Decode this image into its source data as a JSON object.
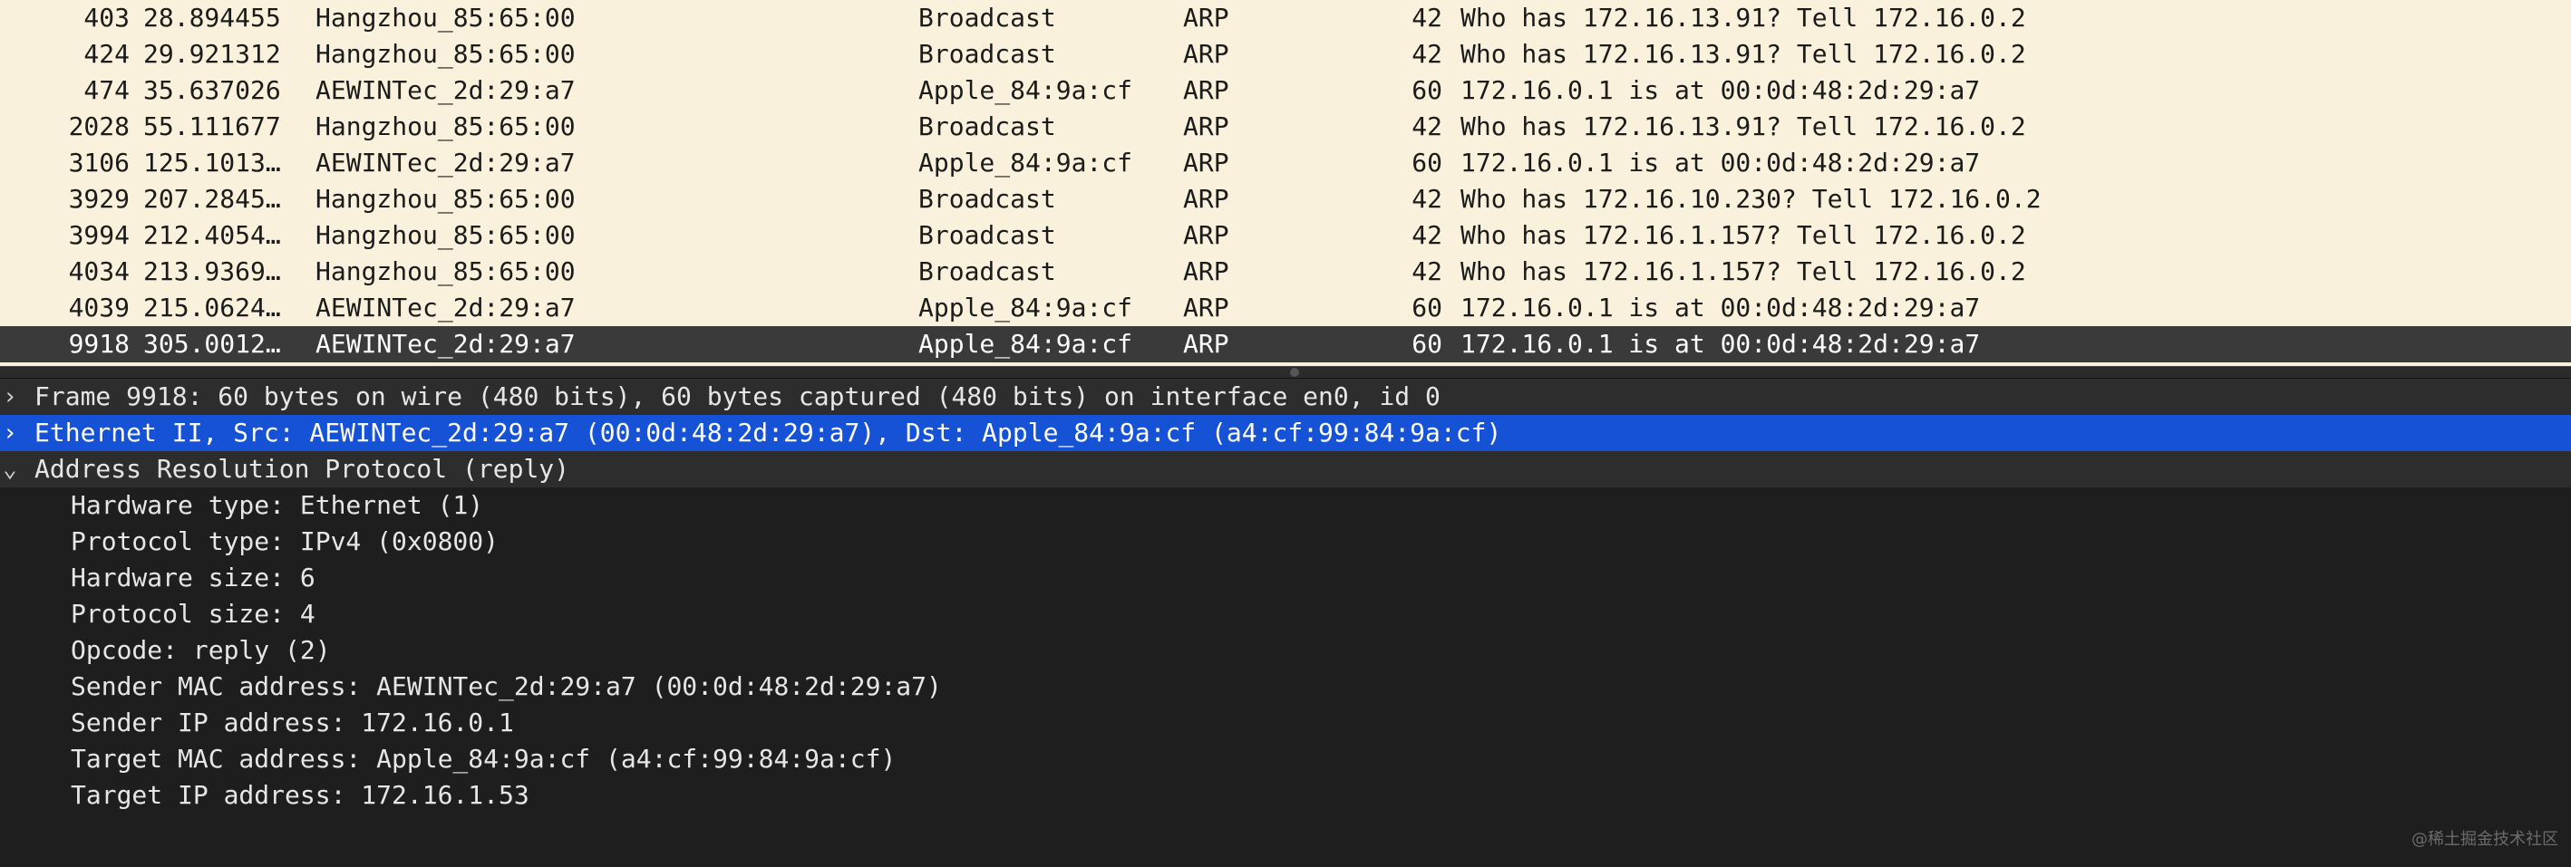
{
  "packets": [
    {
      "no": "403",
      "time": "28.894455",
      "source": "Hangzhou_85:65:00",
      "destination": "Broadcast",
      "protocol": "ARP",
      "length": "42",
      "info": "Who has 172.16.13.91? Tell 172.16.0.2"
    },
    {
      "no": "424",
      "time": "29.921312",
      "source": "Hangzhou_85:65:00",
      "destination": "Broadcast",
      "protocol": "ARP",
      "length": "42",
      "info": "Who has 172.16.13.91? Tell 172.16.0.2"
    },
    {
      "no": "474",
      "time": "35.637026",
      "source": "AEWINTec_2d:29:a7",
      "destination": "Apple_84:9a:cf",
      "protocol": "ARP",
      "length": "60",
      "info": "172.16.0.1 is at 00:0d:48:2d:29:a7"
    },
    {
      "no": "2028",
      "time": "55.111677",
      "source": "Hangzhou_85:65:00",
      "destination": "Broadcast",
      "protocol": "ARP",
      "length": "42",
      "info": "Who has 172.16.13.91? Tell 172.16.0.2"
    },
    {
      "no": "3106",
      "time": "125.1013…",
      "source": "AEWINTec_2d:29:a7",
      "destination": "Apple_84:9a:cf",
      "protocol": "ARP",
      "length": "60",
      "info": "172.16.0.1 is at 00:0d:48:2d:29:a7"
    },
    {
      "no": "3929",
      "time": "207.2845…",
      "source": "Hangzhou_85:65:00",
      "destination": "Broadcast",
      "protocol": "ARP",
      "length": "42",
      "info": "Who has 172.16.10.230? Tell 172.16.0.2"
    },
    {
      "no": "3994",
      "time": "212.4054…",
      "source": "Hangzhou_85:65:00",
      "destination": "Broadcast",
      "protocol": "ARP",
      "length": "42",
      "info": "Who has 172.16.1.157? Tell 172.16.0.2"
    },
    {
      "no": "4034",
      "time": "213.9369…",
      "source": "Hangzhou_85:65:00",
      "destination": "Broadcast",
      "protocol": "ARP",
      "length": "42",
      "info": "Who has 172.16.1.157? Tell 172.16.0.2"
    },
    {
      "no": "4039",
      "time": "215.0624…",
      "source": "AEWINTec_2d:29:a7",
      "destination": "Apple_84:9a:cf",
      "protocol": "ARP",
      "length": "60",
      "info": "172.16.0.1 is at 00:0d:48:2d:29:a7"
    },
    {
      "no": "9918",
      "time": "305.0012…",
      "source": "AEWINTec_2d:29:a7",
      "destination": "Apple_84:9a:cf",
      "protocol": "ARP",
      "length": "60",
      "info": "172.16.0.1 is at 00:0d:48:2d:29:a7"
    }
  ],
  "details": {
    "frame": {
      "arrow": "›",
      "text": "Frame 9918: 60 bytes on wire (480 bits), 60 bytes captured (480 bits) on interface en0, id 0"
    },
    "ethernet": {
      "arrow": "›",
      "text": "Ethernet II, Src: AEWINTec_2d:29:a7 (00:0d:48:2d:29:a7), Dst: Apple_84:9a:cf (a4:cf:99:84:9a:cf)"
    },
    "arp": {
      "arrow": "⌄",
      "text": "Address Resolution Protocol (reply)",
      "fields": [
        "Hardware type: Ethernet (1)",
        "Protocol type: IPv4 (0x0800)",
        "Hardware size: 6",
        "Protocol size: 4",
        "Opcode: reply (2)",
        "Sender MAC address: AEWINTec_2d:29:a7 (00:0d:48:2d:29:a7)",
        "Sender IP address: 172.16.0.1",
        "Target MAC address: Apple_84:9a:cf (a4:cf:99:84:9a:cf)",
        "Target IP address: 172.16.1.53"
      ]
    }
  },
  "watermark": "@稀土掘金技术社区",
  "colors": {
    "list_background": "#f9f1dc",
    "selected_row": "#3a3a3a",
    "detail_background": "#1e1e1e",
    "highlight": "#1652d6"
  }
}
